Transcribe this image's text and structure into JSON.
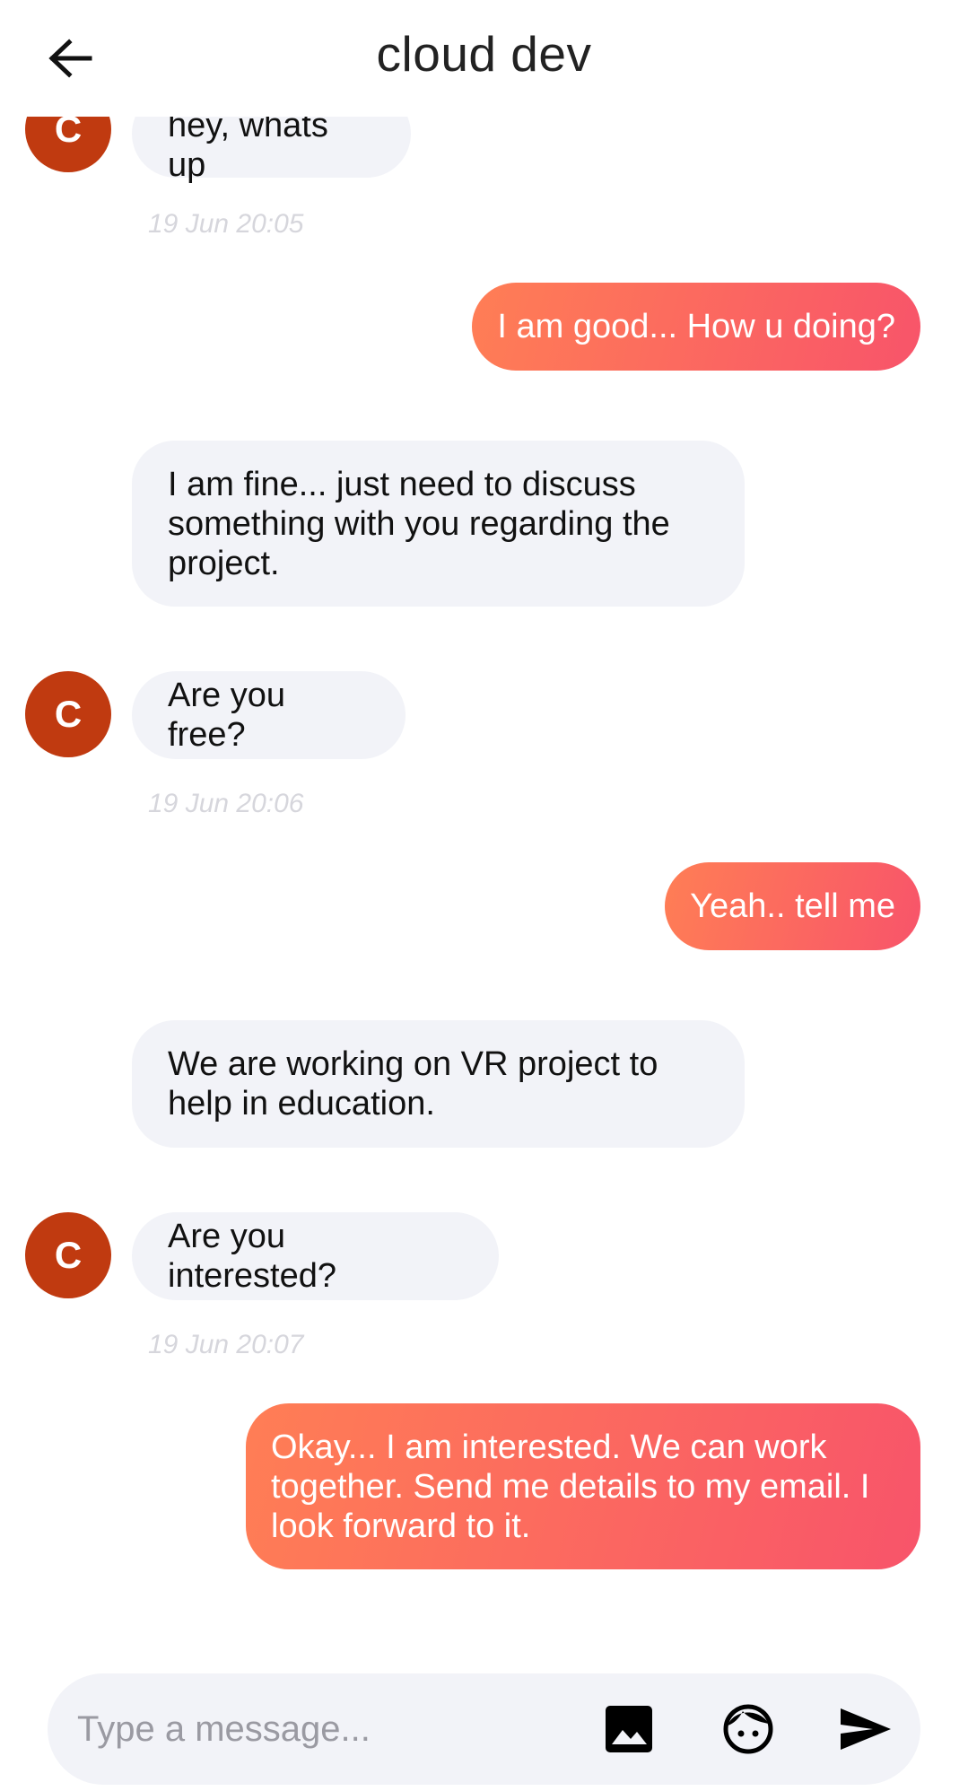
{
  "header": {
    "title": "cloud dev"
  },
  "avatar_letter": "C",
  "messages": [
    {
      "text": "hey, whats up"
    },
    {
      "timestamp": "19 Jun 20:05"
    },
    {
      "text": "I am good... How u doing?"
    },
    {
      "text": "I am fine... just need to discuss something with you regarding the project."
    },
    {
      "text": "Are you free?"
    },
    {
      "timestamp": "19 Jun 20:06"
    },
    {
      "text": "Yeah.. tell me"
    },
    {
      "text": "We are working on VR project to help in education."
    },
    {
      "text": "Are you interested?"
    },
    {
      "timestamp": "19 Jun 20:07"
    },
    {
      "text": "Okay... I am interested. We can work together. Send me details to my email. I look forward to it."
    }
  ],
  "composer": {
    "placeholder": "Type a message...",
    "icons": [
      "image-icon",
      "emoji-face-icon",
      "send-icon"
    ]
  },
  "colors": {
    "avatar": "#c03a10",
    "incoming_bubble": "#f2f3f8",
    "outgoing_gradient_start": "#ff7e55",
    "outgoing_gradient_end": "#f8546a",
    "timestamp": "#d6d6dc"
  }
}
